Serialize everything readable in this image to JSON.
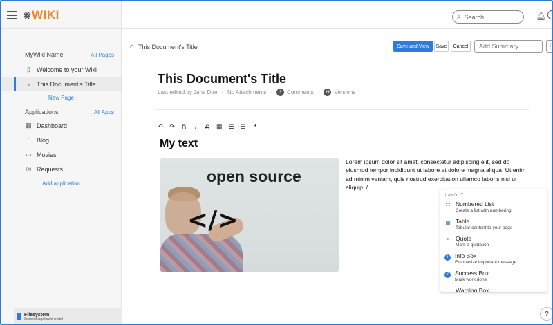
{
  "app": {
    "logo_mark": "⨳",
    "logo_text": "WIKI"
  },
  "sidebar": {
    "wiki_name": "MyWiki Name",
    "all_pages": "All Pages",
    "pages": [
      {
        "label": "Welcome to your Wiki",
        "icon": "page-icon",
        "active": false
      },
      {
        "label": "This Document's Title",
        "icon": "chevron-right-icon",
        "active": true
      }
    ],
    "new_page": "New Page",
    "applications": "Applications",
    "all_apps": "All Apps",
    "apps": [
      {
        "label": "Dashboard",
        "icon": "grid-icon"
      },
      {
        "label": "Blog",
        "icon": "rss-icon"
      },
      {
        "label": "Movies",
        "icon": "tv-icon"
      },
      {
        "label": "Requests",
        "icon": "check-circle-icon"
      }
    ],
    "add_application": "Add application",
    "filesystem": {
      "name": "Filesystem",
      "path": "/home/thiago/xwiki-cristal"
    }
  },
  "topbar": {
    "search_placeholder": "Search"
  },
  "breadcrumb": {
    "label": "This Document's Title"
  },
  "toolbar": {
    "save_view": "Save and View",
    "save": "Save",
    "cancel": "Cancel",
    "summary_placeholder": "Add Summary...",
    "more": "⋮"
  },
  "document": {
    "title": "This Document's Title",
    "last_edited": "Last edited by Jane Doe",
    "attachments": "No Attachments",
    "comments_count": "3",
    "comments_label": "Comments",
    "versions_count": "21",
    "versions_label": "Versions",
    "heading": "My text",
    "image_text": "open source",
    "image_code": "</>",
    "paragraph": "Lorem ipsum dolor sit amet, consectetur adipiscing elit, sed do eiusmod tempor incididunt ut labore et dolore magna aliqua. Ut enim ad minim veniam, quis nostrud exercitation ullamco laboris nisi ut aliquip. /"
  },
  "editor_toolbar": [
    {
      "name": "undo-icon",
      "glyph": "↶"
    },
    {
      "name": "redo-icon",
      "glyph": "↷"
    },
    {
      "name": "bold-icon",
      "glyph": "B"
    },
    {
      "name": "italic-icon",
      "glyph": "I"
    },
    {
      "name": "strikethrough-icon",
      "glyph": "S"
    },
    {
      "name": "table-icon",
      "glyph": "▦"
    },
    {
      "name": "bullet-list-icon",
      "glyph": "☰"
    },
    {
      "name": "numbered-list-icon",
      "glyph": "☷"
    },
    {
      "name": "quote-icon",
      "glyph": "❝"
    }
  ],
  "slash_menu": {
    "header": "LAYOUT",
    "items": [
      {
        "title": "Numbered List",
        "desc": "Create a list with numbering",
        "icon": "numbered-list-icon"
      },
      {
        "title": "Table",
        "desc": "Tabular content to your page",
        "icon": "table-icon"
      },
      {
        "title": "Quote",
        "desc": "Mark a quotation",
        "icon": "quote-icon"
      },
      {
        "title": "Info Box",
        "desc": "Emphasize important message",
        "icon": "info-icon"
      },
      {
        "title": "Success Box",
        "desc": "Mark work done",
        "icon": "check-icon"
      },
      {
        "title": "Warning Box",
        "desc": "",
        "icon": "warning-icon"
      }
    ]
  },
  "help": {
    "label": "?"
  },
  "colors": {
    "accent": "#2f7bd9",
    "brand": "#f0862b"
  }
}
